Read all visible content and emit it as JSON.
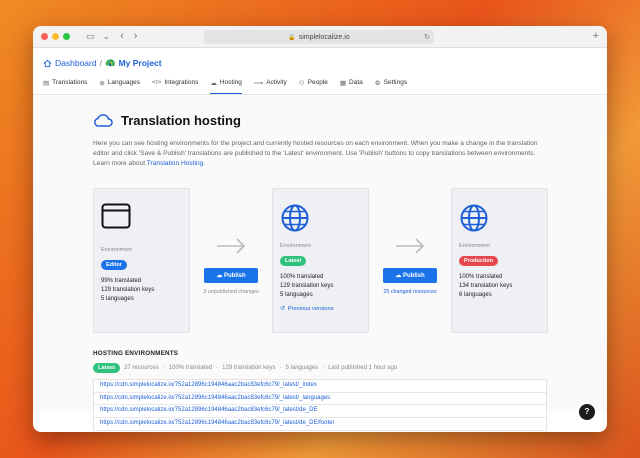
{
  "browser": {
    "url": "simplelocalize.io",
    "traffic_lights": [
      "#fe5f57",
      "#febc2e",
      "#28c840"
    ]
  },
  "breadcrumb": {
    "dashboard": "Dashboard",
    "separator": "/",
    "project_emoji": "🦚",
    "project": "My Project"
  },
  "nav": [
    {
      "label": "Translations",
      "icon": "translations-icon"
    },
    {
      "label": "Languages",
      "icon": "languages-icon"
    },
    {
      "label": "Integrations",
      "icon": "code-icon"
    },
    {
      "label": "Hosting",
      "icon": "cloud-icon"
    },
    {
      "label": "Activity",
      "icon": "activity-icon"
    },
    {
      "label": "People",
      "icon": "people-icon"
    },
    {
      "label": "Data",
      "icon": "database-icon"
    },
    {
      "label": "Settings",
      "icon": "gear-icon"
    }
  ],
  "page": {
    "title": "Translation hosting",
    "description": "Here you can see hosting environments for the project and currently hosted resources on each environment. When you make a change in the translation editor and click 'Save & Publish' translations are published to the 'Latest' environment. Use 'Publish' buttons to copy translations between environments. Learn more about ",
    "learn_more_link": "Translation Hosting",
    "description_end": "."
  },
  "cards": [
    {
      "env_label": "Environment",
      "badge": "Editor",
      "badge_color": "#1a73e8",
      "translated": "99% translated",
      "keys": "129 translation keys",
      "languages": "5 languages"
    },
    {
      "env_label": "Environment",
      "badge": "Latest",
      "badge_color": "#2ec27e",
      "translated": "100% translated",
      "keys": "129 translation keys",
      "languages": "5 languages",
      "previous": "Previous versions"
    },
    {
      "env_label": "Environment",
      "badge": "Production",
      "badge_color": "#e5484d",
      "translated": "100% translated",
      "keys": "134 translation keys",
      "languages": "6 languages"
    }
  ],
  "publish": [
    {
      "label": "Publish",
      "note": "3 unpublished changes"
    },
    {
      "label": "Publish",
      "note": "25 changed resources"
    }
  ],
  "hosting": {
    "title": "HOSTING ENVIRONMENTS",
    "badge": "Latest",
    "meta": [
      "37 resources",
      "·",
      "100% translated",
      "·",
      "129 translation keys",
      "·",
      "5 languages",
      "·",
      "Last published 1 hour ago"
    ],
    "urls": [
      "https://cdn.simplelocalize.io/752a12896c194846aac2bac83efc6c79/_latest/_index",
      "https://cdn.simplelocalize.io/752a12896c194846aac2bac83efc6c79/_latest/_languages",
      "https://cdn.simplelocalize.io/752a12896c194846aac2bac83efc6c79/_latest/de_DE",
      "https://cdn.simplelocalize.io/752a12896c194846aac2bac83efc6c79/_latest/de_DE/footer"
    ]
  },
  "help": "?"
}
